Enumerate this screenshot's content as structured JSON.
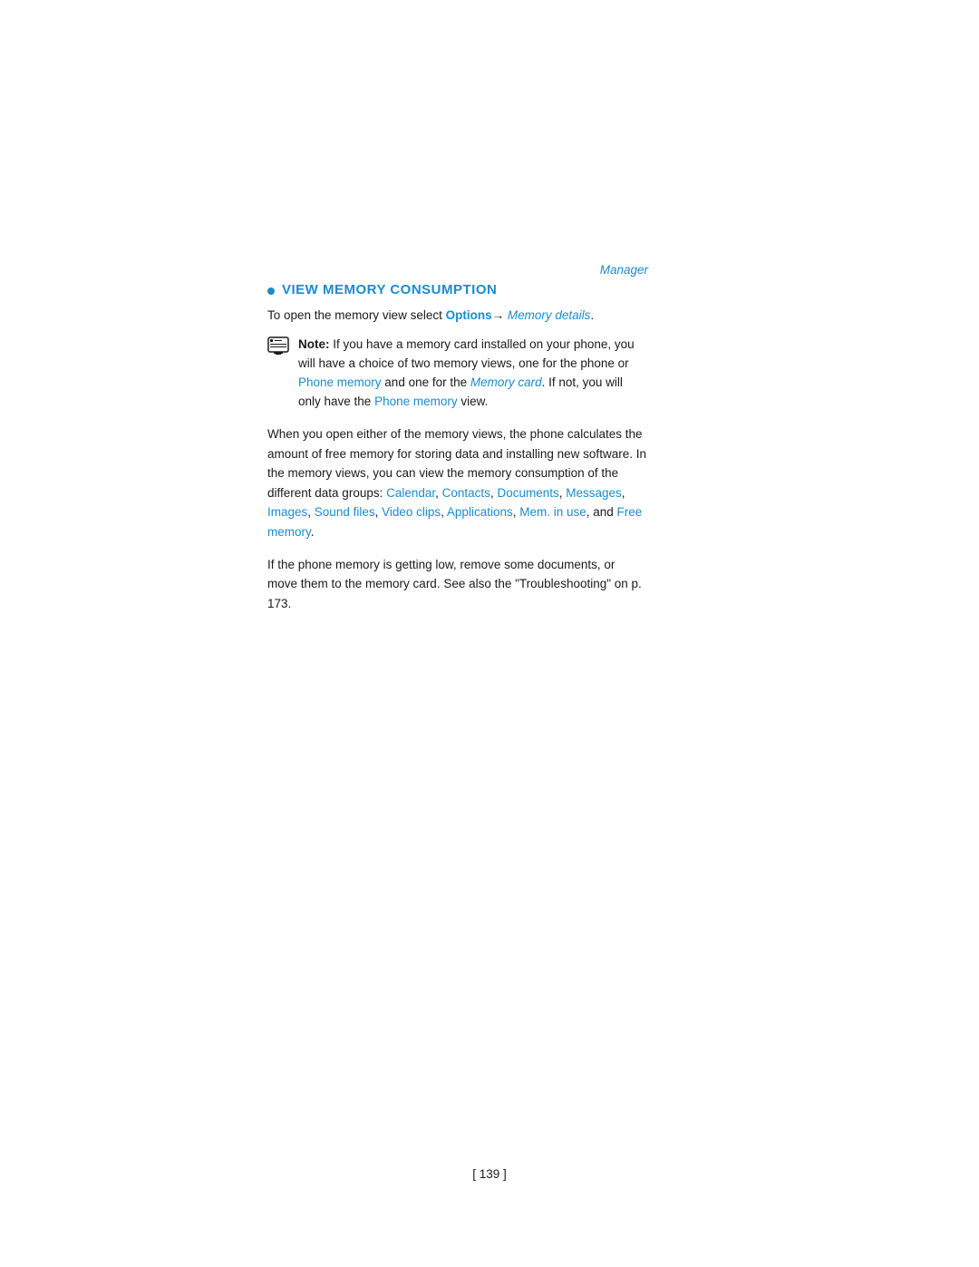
{
  "page": {
    "manager_label": "Manager",
    "section_heading": "VIEW MEMORY CONSUMPTION",
    "intro_text_pre": "To open the memory view select ",
    "intro_options": "Options",
    "intro_arrow": "→",
    "intro_memory_details": "Memory details",
    "intro_text_post": ".",
    "note_label": "Note:",
    "note_text_1": " If you have a memory card installed on your phone, you will have a choice of two memory views, one for the phone or ",
    "note_phone_memory_1": "Phone memory",
    "note_text_2": " and one for the ",
    "note_memory_card": "Memory card",
    "note_text_3": ". If not, you will only have the ",
    "note_phone_memory_2": "Phone memory",
    "note_text_4": " view.",
    "body_paragraph_1": "When you open either of the memory views, the phone calculates the amount of free memory for storing data and installing new software. In the memory views, you can view the memory consumption of the different data groups: ",
    "link_calendar": "Calendar",
    "link_contacts": "Contacts",
    "link_documents": "Documents",
    "link_messages": "Messages",
    "link_images": "Images",
    "link_sound_files": "Sound files",
    "link_video_clips": "Video clips",
    "link_applications": "Applications",
    "link_mem_in_use": "Mem. in use",
    "link_free_memory": "Free memory",
    "body_paragraph_1_end": ", and ",
    "body_paragraph_1_close": ".",
    "body_paragraph_2": "If the phone memory is getting low, remove some documents, or move them to the memory card. See also the \"Troubleshooting\" on p. 173.",
    "page_number": "[ 139 ]"
  }
}
